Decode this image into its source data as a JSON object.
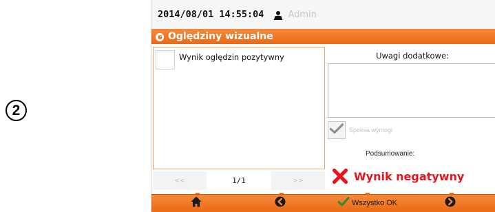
{
  "step_number": "2",
  "statusbar": {
    "datetime": "2014/08/01 14:55:04",
    "user": "Admin",
    "user_icon": "person-icon"
  },
  "title": {
    "icon": "eye-icon",
    "text": "Oględziny wizualne"
  },
  "checklist": {
    "items": [
      {
        "label": "Wynik oględzin pozytywny",
        "checked": false
      }
    ]
  },
  "pager": {
    "prev_label": "<<",
    "page": "1/1",
    "next_label": ">>"
  },
  "notes": {
    "label": "Uwagi dodatkowe:",
    "value": ""
  },
  "meets_requirements": {
    "label": "Spełnia wymogi",
    "enabled": false
  },
  "summary": {
    "label": "Podsumowanie:",
    "result_text": "Wynik negatywny",
    "result_icon": "red-x-icon",
    "result_color": "#e8141c"
  },
  "bottombar": {
    "all_ok_label": "Wszystko OK",
    "icons": [
      "home-icon",
      "back-arrow-icon",
      "check-icon",
      "forward-arrow-icon"
    ]
  },
  "colors": {
    "accent": "#ea6a16",
    "accent_light": "#f58a3a"
  }
}
